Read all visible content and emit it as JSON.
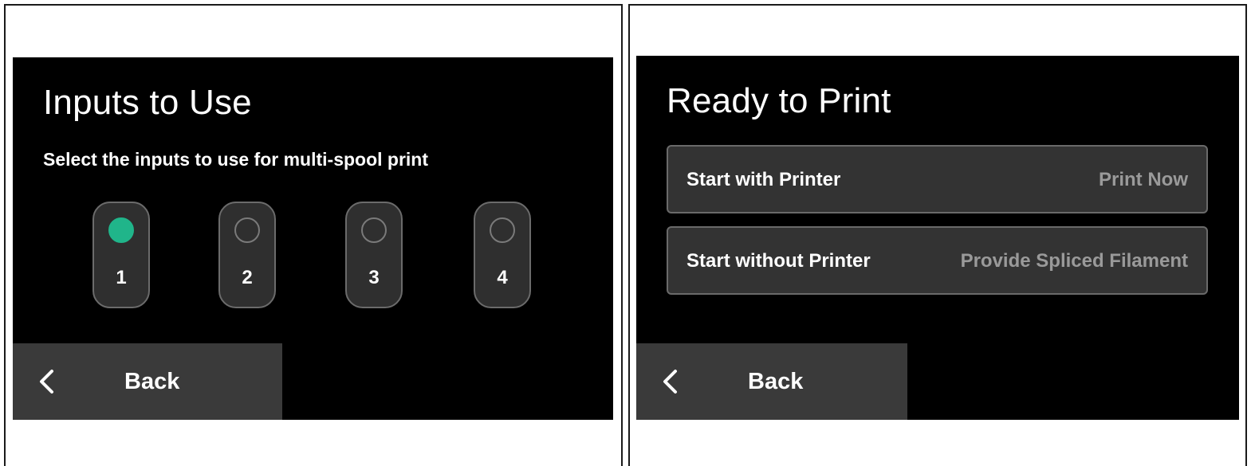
{
  "left_screen": {
    "title": "Inputs to Use",
    "subtitle": "Select the inputs to use for multi-spool print",
    "inputs": [
      {
        "label": "1",
        "selected": true
      },
      {
        "label": "2",
        "selected": false
      },
      {
        "label": "3",
        "selected": false
      },
      {
        "label": "4",
        "selected": false
      }
    ],
    "back_label": "Back"
  },
  "right_screen": {
    "title": "Ready to Print",
    "options": [
      {
        "label": "Start with Printer",
        "value": "Print Now"
      },
      {
        "label": "Start without Printer",
        "value": "Provide Spliced Filament"
      }
    ],
    "back_label": "Back"
  },
  "colors": {
    "selected_accent": "#20b58a",
    "screen_background": "#000000",
    "button_background": "#3a3a3a"
  }
}
